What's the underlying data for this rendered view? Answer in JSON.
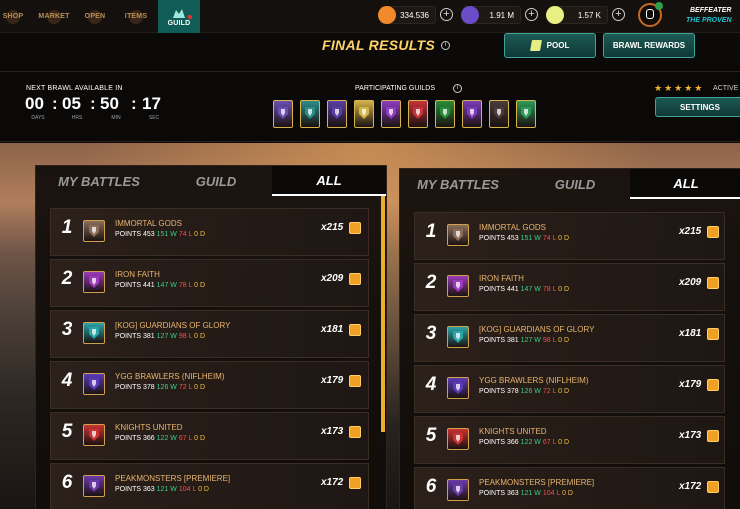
{
  "nav": {
    "tabs": [
      "SHOP",
      "MARKET",
      "OPEN",
      "ITEMS",
      "GUILD"
    ],
    "currencies": [
      {
        "icon": "dec-coin-icon",
        "value": "334.536",
        "color": "#f08a2a"
      },
      {
        "icon": "sps-crystal-icon",
        "value": "1.91 M",
        "color": "#6a4cc8"
      },
      {
        "icon": "voucher-icon",
        "value": "1.57 K",
        "color": "#e8ef83"
      }
    ],
    "player": {
      "name": "BEFFEATER",
      "title": "THE PROVEN"
    }
  },
  "header": {
    "title": "FINAL RESULTS",
    "pool_button": "POOL",
    "rewards_button": "BRAWL REWARDS"
  },
  "brawl": {
    "next_label": "NEXT BRAWL AVAILABLE IN",
    "countdown": {
      "days": "00",
      "hrs": "05",
      "min": "50",
      "sec": "17"
    },
    "units": {
      "days": "DAYS",
      "hrs": "HRS",
      "min": "MIN",
      "sec": "SEC"
    },
    "participating_label": "PARTICIPATING GUILDS",
    "guild_banner_colors": [
      "#6b4fb0",
      "#2c8d8a",
      "#5b3ea3",
      "#d3b247",
      "#8e3cc0",
      "#c8323a",
      "#2a8b3a",
      "#7d3bb8",
      "#4a3c3a",
      "#2e9a56"
    ],
    "stars": "★★★★★",
    "active_label": "ACTIVE",
    "settings_button": "SETTINGS"
  },
  "tabs": {
    "my_battles": "MY BATTLES",
    "guild": "GUILD",
    "all": "ALL"
  },
  "rankings": [
    {
      "rank": "1",
      "name": "IMMORTAL GODS",
      "points": "453",
      "wins": "151 W",
      "losses": "74 L",
      "draws": "0 D",
      "reward": "x215",
      "icon_color": "#8a6e5a"
    },
    {
      "rank": "2",
      "name": "IRON FAITH",
      "points": "441",
      "wins": "147 W",
      "losses": "78 L",
      "draws": "0 D",
      "reward": "x209",
      "icon_color": "#9a3ab8"
    },
    {
      "rank": "3",
      "name": "[KOG] GUARDIANS OF GLORY",
      "points": "381",
      "wins": "127 W",
      "losses": "98 L",
      "draws": "0 D",
      "reward": "x181",
      "icon_color": "#2aa4a8"
    },
    {
      "rank": "4",
      "name": "YGG BRAWLERS (NIFLHEIM)",
      "points": "378",
      "wins": "126 W",
      "losses": "72 L",
      "draws": "0 D",
      "reward": "x179",
      "icon_color": "#5b3ab8"
    },
    {
      "rank": "5",
      "name": "KNIGHTS UNITED",
      "points": "366",
      "wins": "122 W",
      "losses": "67 L",
      "draws": "0 D",
      "reward": "x173",
      "icon_color": "#c83232"
    },
    {
      "rank": "6",
      "name": "PEAKMONSTERS [PREMIERE]",
      "points": "363",
      "wins": "121 W",
      "losses": "104 L",
      "draws": "0 D",
      "reward": "x172",
      "icon_color": "#6a3aa8"
    }
  ],
  "labels": {
    "points": "POINTS"
  }
}
